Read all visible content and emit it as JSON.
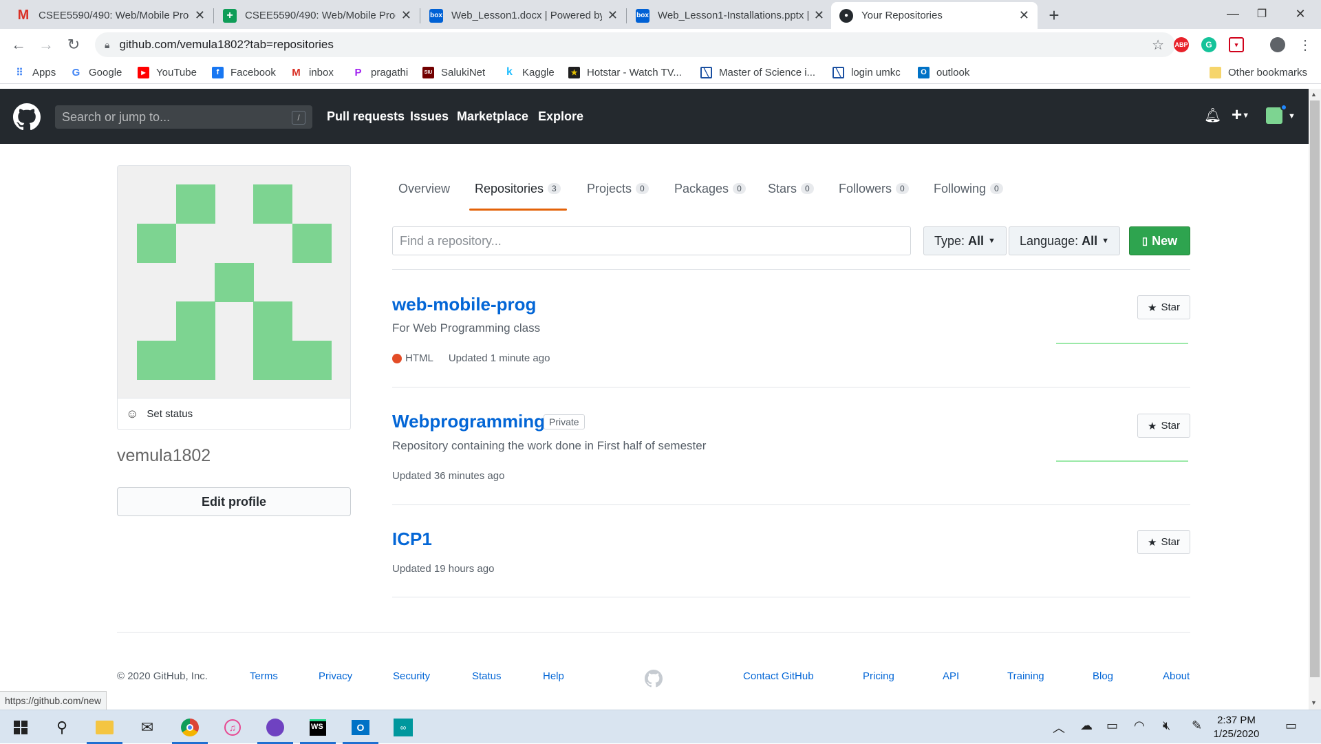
{
  "browser": {
    "tabs": [
      {
        "title": "CSEE5590/490: Web/Mobile Prog",
        "icon": "gmail-icon"
      },
      {
        "title": "CSEE5590/490: Web/Mobile Prog",
        "icon": "sheets-icon"
      },
      {
        "title": "Web_Lesson1.docx | Powered by",
        "icon": "box-icon"
      },
      {
        "title": "Web_Lesson1-Installations.pptx |",
        "icon": "box-icon"
      },
      {
        "title": "Your Repositories",
        "icon": "github-icon"
      }
    ],
    "url": "github.com/vemula1802?tab=repositories",
    "bookmarks": [
      "Apps",
      "Google",
      "YouTube",
      "Facebook",
      "inbox",
      "pragathi",
      "SalukiNet",
      "Kaggle",
      "Hotstar - Watch TV...",
      "Master of Science i...",
      "login umkc",
      "outlook"
    ],
    "other_bookmarks": "Other bookmarks",
    "status_url": "https://github.com/new"
  },
  "header": {
    "search_placeholder": "Search or jump to...",
    "search_key": "/",
    "nav": [
      "Pull requests",
      "Issues",
      "Marketplace",
      "Explore"
    ]
  },
  "profile": {
    "username": "vemula1802",
    "set_status": "Set status",
    "edit_profile": "Edit profile"
  },
  "profile_tabs": [
    {
      "label": "Overview",
      "count": null
    },
    {
      "label": "Repositories",
      "count": "3"
    },
    {
      "label": "Projects",
      "count": "0"
    },
    {
      "label": "Packages",
      "count": "0"
    },
    {
      "label": "Stars",
      "count": "0"
    },
    {
      "label": "Followers",
      "count": "0"
    },
    {
      "label": "Following",
      "count": "0"
    }
  ],
  "filters": {
    "search_placeholder": "Find a repository...",
    "type_label": "Type:",
    "type_value": "All",
    "language_label": "Language:",
    "language_value": "All",
    "new_label": "New"
  },
  "repos": [
    {
      "name": "web-mobile-prog",
      "description": "For Web Programming class",
      "language": "HTML",
      "language_color": "#e34c26",
      "updated": "Updated 1 minute ago",
      "star": "Star"
    },
    {
      "name": "Webprogramming",
      "badge": "Private",
      "description": "Repository containing the work done in First half of semester",
      "updated": "Updated 36 minutes ago",
      "star": "Star"
    },
    {
      "name": "ICP1",
      "updated": "Updated 19 hours ago",
      "star": "Star"
    }
  ],
  "footer": {
    "copyright": "© 2020 GitHub, Inc.",
    "left_links": [
      "Terms",
      "Privacy",
      "Security",
      "Status",
      "Help"
    ],
    "right_links": [
      "Contact GitHub",
      "Pricing",
      "API",
      "Training",
      "Blog",
      "About"
    ]
  },
  "taskbar": {
    "time": "2:37 PM",
    "date": "1/25/2020"
  },
  "colors": {
    "accent_orange": "#e36209",
    "link_blue": "#0366d6",
    "new_button_green": "#2ea44f",
    "identicon_green": "#7dd491",
    "header_dark": "#24292e"
  }
}
